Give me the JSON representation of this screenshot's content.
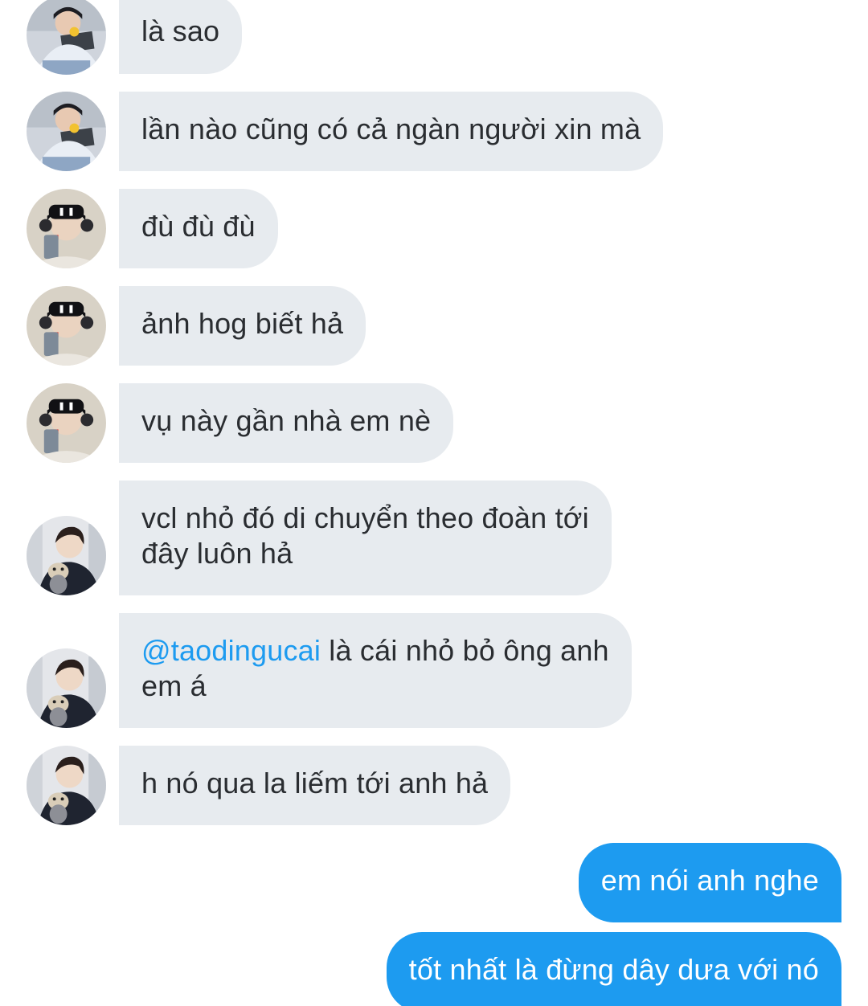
{
  "messages": [
    {
      "sender": "user-a",
      "text": "là sao"
    },
    {
      "sender": "user-a",
      "text": "lần nào cũng có cả ngàn người xin mà"
    },
    {
      "sender": "user-b",
      "text": "đù đù đù"
    },
    {
      "sender": "user-b",
      "text": "ảnh hog biết hả"
    },
    {
      "sender": "user-b",
      "text": "vụ này gần nhà em nè"
    },
    {
      "sender": "user-c",
      "line1": "vcl nhỏ đó di chuyển theo đoàn tới",
      "line2": "đây luôn hả"
    },
    {
      "sender": "user-c",
      "mention": "@taodingucai",
      "line1_rest": " là cái nhỏ bỏ ông anh",
      "line2": "em á"
    },
    {
      "sender": "user-c",
      "text": "h nó qua la liếm tới anh hả"
    },
    {
      "sender": "me",
      "text": "em nói anh nghe"
    },
    {
      "sender": "me",
      "text": "tốt nhất là đừng dây dưa với nó"
    }
  ],
  "colors": {
    "incoming_bubble": "#e7ebef",
    "outgoing_bubble": "#1d9bf0",
    "mention": "#1d9bf0",
    "text": "#2a2d31"
  }
}
